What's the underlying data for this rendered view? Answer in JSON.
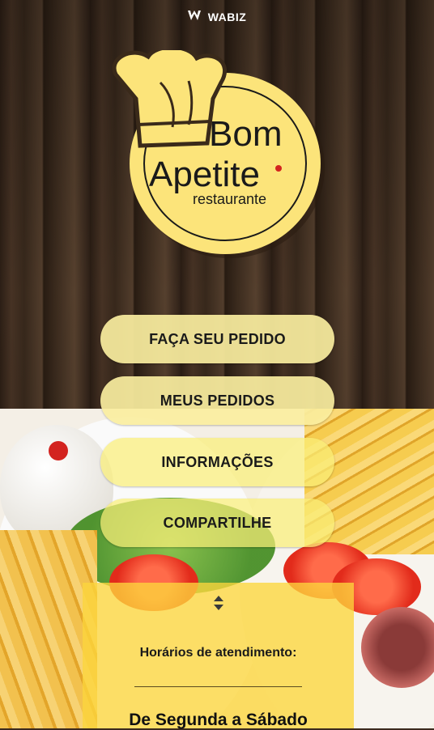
{
  "header": {
    "brand_label": "WABIZ"
  },
  "logo": {
    "line1": "Bom",
    "line2": "Apetite",
    "line3": "restaurante"
  },
  "menu": {
    "items": [
      {
        "label": "FAÇA SEU PEDIDO"
      },
      {
        "label": "MEUS PEDIDOS"
      },
      {
        "label": "INFORMAÇÕES"
      },
      {
        "label": "COMPARTILHE"
      }
    ]
  },
  "hours": {
    "title": "Horários de atendimento:",
    "days": "De Segunda a Sábado"
  },
  "colors": {
    "button_bg": "#FAEEA0",
    "logo_yellow": "#FCE47A",
    "hours_panel": "#FCD63C",
    "logo_text": "#1a1a1a",
    "logo_accent": "#d3231f"
  },
  "icons": {
    "brand": "wabiz-logo-icon",
    "expand": "chevron-up-down-icon"
  }
}
